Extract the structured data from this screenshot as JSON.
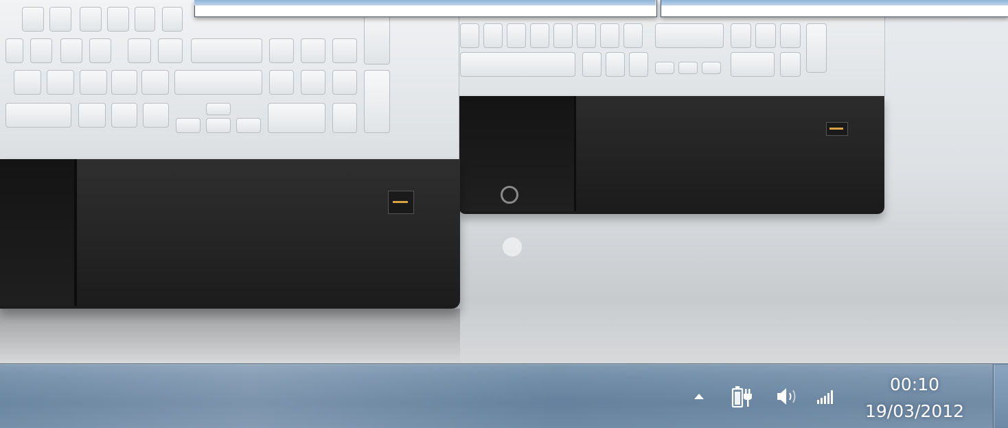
{
  "taskbar": {
    "tray": {
      "show_hidden_icon": "triangle-up-icon",
      "power_icon": "power-plug-icon",
      "volume_icon": "speaker-icon",
      "network_icon": "signal-bars-icon"
    },
    "clock": {
      "time": "00:10",
      "date": "19/03/2012"
    }
  },
  "colors": {
    "taskbar": "#6d89a5",
    "text": "#ffffff"
  }
}
